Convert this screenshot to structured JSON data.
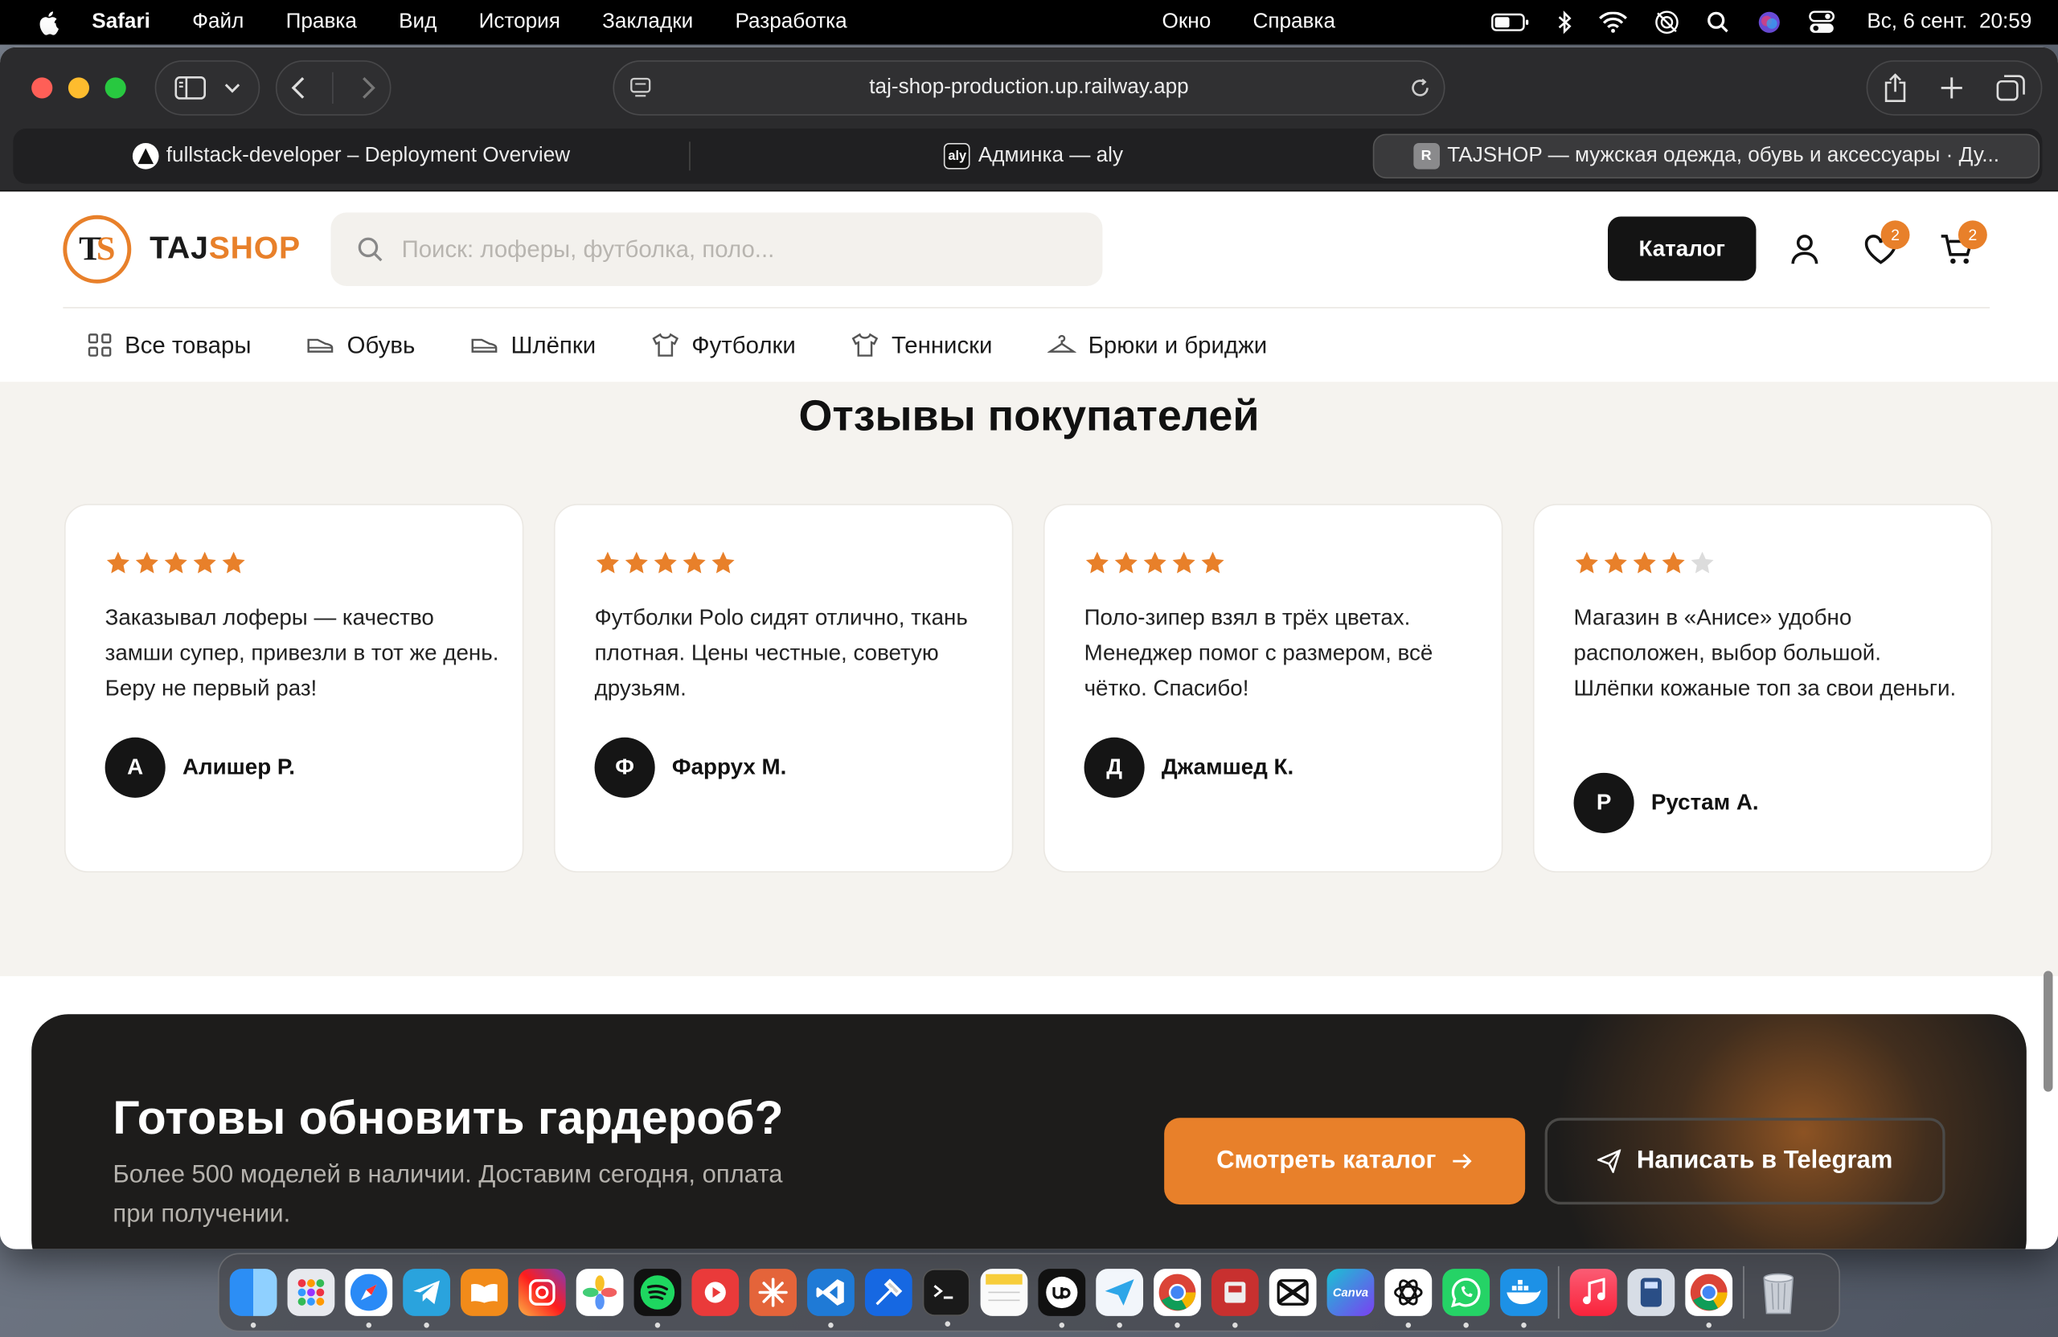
{
  "menubar": {
    "app": "Safari",
    "items": [
      "Файл",
      "Правка",
      "Вид",
      "История",
      "Закладки",
      "Разработка",
      "Окно",
      "Справка"
    ],
    "clock": "Вс, 6 сент.  20:59"
  },
  "browser": {
    "url": "taj-shop-production.up.railway.app",
    "tabs": [
      {
        "title": "fullstack-developer – Deployment Overview"
      },
      {
        "title": "Админка — aly",
        "favicon": "aly"
      },
      {
        "title": "TAJSHOP — мужская одежда, обувь и аксессуары · Ду...",
        "favicon": "R"
      }
    ]
  },
  "site": {
    "logo_letters": {
      "t": "T",
      "s": "S"
    },
    "brand": {
      "part1": "TAJ",
      "part2": "SHOP"
    },
    "search_placeholder": "Поиск: лоферы, футболка, поло...",
    "catalog_button": "Каталог",
    "wishlist_count": "2",
    "cart_count": "2",
    "nav": [
      "Все товары",
      "Обувь",
      "Шлёпки",
      "Футболки",
      "Тенниски",
      "Брюки и бриджи"
    ],
    "colors": {
      "accent": "#e8802a",
      "dark": "#141414"
    }
  },
  "reviews": {
    "title": "Отзывы покупателей",
    "items": [
      {
        "rating": 5,
        "text": "Заказывал лоферы — качество замши супер, привезли в тот же день. Беру не первый раз!",
        "initial": "А",
        "name": "Алишер Р."
      },
      {
        "rating": 5,
        "text": "Футболки Polo сидят отлично, ткань плотная. Цены честные, советую друзьям.",
        "initial": "Ф",
        "name": "Фаррух М."
      },
      {
        "rating": 5,
        "text": "Поло-зипер взял в трёх цветах. Менеджер помог с размером, всё чётко. Спасибо!",
        "initial": "Д",
        "name": "Джамшед К."
      },
      {
        "rating": 4,
        "text": "Магазин в «Анисе» удобно расположен, выбор большой. Шлёпки кожаные топ за свои деньги.",
        "initial": "Р",
        "name": "Рустам А."
      }
    ]
  },
  "cta": {
    "title": "Готовы обновить гардероб?",
    "subtitle": "Более 500 моделей в наличии. Доставим сегодня, оплата при получении.",
    "primary": "Смотреть каталог",
    "secondary": "Написать в Telegram"
  },
  "dock": {
    "apps": [
      "finder-icon",
      "launchpad-icon",
      "safari-icon",
      "telegram-icon",
      "books-icon",
      "instagram-icon",
      "photos-icon",
      "spotify-icon",
      "youtube-icon",
      "claude-icon",
      "vscode-icon",
      "xcode-icon",
      "terminal-icon",
      "notes-icon",
      "upwork-icon",
      "paper-plane-icon",
      "chrome-icon",
      "archive-icon",
      "capcut-icon",
      "canva-icon",
      "chatgpt-icon",
      "whatsapp-icon",
      "docker-icon",
      "music-icon",
      "disk-icon",
      "chrome-icon",
      "trash-icon"
    ],
    "canva_label": "Canva"
  }
}
